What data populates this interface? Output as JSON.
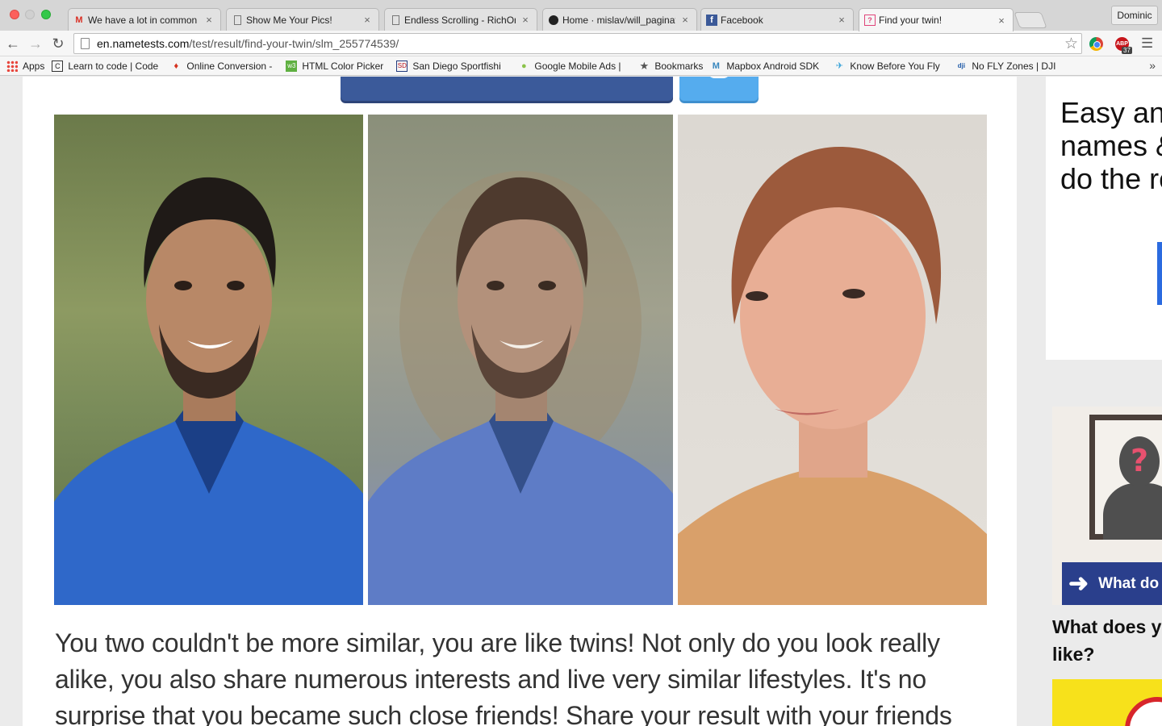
{
  "window": {
    "controls": [
      "close",
      "minimize",
      "maximize"
    ],
    "profile_name": "Dominic"
  },
  "tabs": [
    {
      "title": "We have a lot in common -",
      "icon": "gmail-icon",
      "active": false
    },
    {
      "title": "Show Me Your Pics!",
      "icon": "page-icon",
      "active": false
    },
    {
      "title": "Endless Scrolling - RichOnl",
      "icon": "page-icon",
      "active": false
    },
    {
      "title": "Home · mislav/will_paginate",
      "icon": "github-icon",
      "active": false
    },
    {
      "title": "Facebook",
      "icon": "facebook-icon",
      "active": false
    },
    {
      "title": "Find your twin!",
      "icon": "nametests-icon",
      "active": true
    }
  ],
  "toolbar": {
    "url_host": "en.nametests.com",
    "url_path": "/test/result/find-your-twin/slm_255774539/",
    "abp_label": "ABP",
    "abp_badge": "37"
  },
  "bookmarks": [
    {
      "label": "Apps",
      "icon": "apps-grid-icon"
    },
    {
      "label": "Learn to code | Code",
      "icon": "codecademy-icon"
    },
    {
      "label": "Online Conversion -",
      "icon": "conversion-icon"
    },
    {
      "label": "HTML Color Picker",
      "icon": "w3-icon"
    },
    {
      "label": "San Diego Sportfishi",
      "icon": "sportfishing-icon"
    },
    {
      "label": "Google Mobile Ads |",
      "icon": "android-icon"
    },
    {
      "label": "Bookmarks",
      "icon": "star-icon"
    },
    {
      "label": "Mapbox Android SDK",
      "icon": "mapbox-icon"
    },
    {
      "label": "Know Before You Fly",
      "icon": "drone-icon"
    },
    {
      "label": "No FLY Zones | DJI",
      "icon": "dji-icon"
    }
  ],
  "page": {
    "result_text": "You two couldn't be more similar, you are like twins! Not only do you look really alike, you also share numerous interests and live very similar lifestyles. It's no surprise that you became such close friends! Share your result with your friends",
    "sidebar": {
      "promo_headline": "Easy and\nnames &\ndo the re",
      "quiz_banner": "What do",
      "quiz_title": "What does y\nlike?"
    }
  },
  "colors": {
    "facebook_blue": "#3b5a9a",
    "twitter_blue": "#55acee",
    "quiz_banner": "#2a3f8c",
    "yellow_ad": "#f7e11b"
  }
}
